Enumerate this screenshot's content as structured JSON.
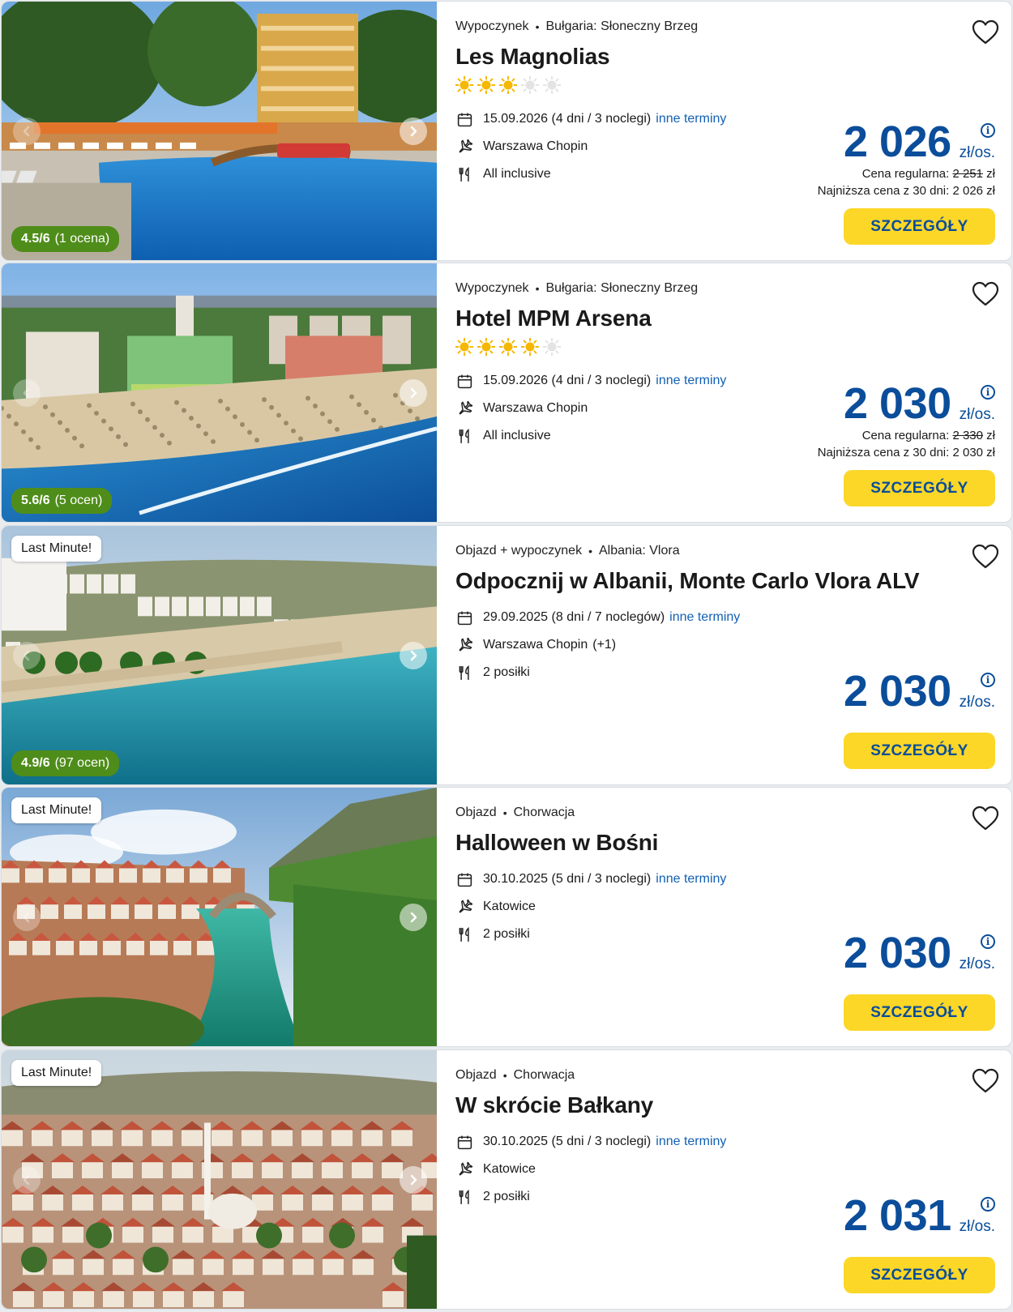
{
  "offers": [
    {
      "category": "Wypoczynek",
      "location": "Bułgaria: Słoneczny Brzeg",
      "title": "Les Magnolias",
      "stars_filled": 3,
      "stars_total": 5,
      "date": "15.09.2026 (4 dni / 3 noclegi)",
      "date_link": "inne terminy",
      "airport": "Warszawa Chopin",
      "airport_extra": "",
      "board": "All inclusive",
      "price": "2 026",
      "price_unit": "zł/os.",
      "regular_label": "Cena regularna: ",
      "regular_price": "2 251",
      "regular_currency": " zł",
      "lowest_price": "Najniższa cena z 30 dni: 2 026 zł",
      "rating_score": "4.5/6",
      "rating_count": "(1 ocena)",
      "badge": "",
      "button": "SZCZEGÓŁY",
      "photo": "pool"
    },
    {
      "category": "Wypoczynek",
      "location": "Bułgaria: Słoneczny Brzeg",
      "title": "Hotel MPM Arsena",
      "stars_filled": 4,
      "stars_total": 5,
      "date": "15.09.2026 (4 dni / 3 noclegi)",
      "date_link": "inne terminy",
      "airport": "Warszawa Chopin",
      "airport_extra": "",
      "board": "All inclusive",
      "price": "2 030",
      "price_unit": "zł/os.",
      "regular_label": "Cena regularna: ",
      "regular_price": "2 330",
      "regular_currency": " zł",
      "lowest_price": "Najniższa cena z 30 dni: 2 030 zł",
      "rating_score": "5.6/6",
      "rating_count": "(5 ocen)",
      "badge": "",
      "button": "SZCZEGÓŁY",
      "photo": "beach"
    },
    {
      "category": "Objazd + wypoczynek",
      "location": "Albania: Vlora",
      "title": "Odpocznij w Albanii, Monte Carlo Vlora ALV",
      "stars_filled": 0,
      "stars_total": 0,
      "date": "29.09.2025 (8 dni / 7 noclegów)",
      "date_link": "inne terminy",
      "airport": "Warszawa Chopin",
      "airport_extra": "(+1)",
      "board": "2 posiłki",
      "price": "2 030",
      "price_unit": "zł/os.",
      "regular_label": "",
      "regular_price": "",
      "regular_currency": "",
      "lowest_price": "",
      "rating_score": "4.9/6",
      "rating_count": "(97 ocen)",
      "badge": "Last Minute!",
      "button": "SZCZEGÓŁY",
      "photo": "coast"
    },
    {
      "category": "Objazd",
      "location": "Chorwacja",
      "title": "Halloween w Bośni",
      "stars_filled": 0,
      "stars_total": 0,
      "date": "30.10.2025 (5 dni / 3 noclegi)",
      "date_link": "inne terminy",
      "airport": "Katowice",
      "airport_extra": "",
      "board": "2 posiłki",
      "price": "2 030",
      "price_unit": "zł/os.",
      "regular_label": "",
      "regular_price": "",
      "regular_currency": "",
      "lowest_price": "",
      "rating_score": "",
      "rating_count": "",
      "badge": "Last Minute!",
      "button": "SZCZEGÓŁY",
      "photo": "river"
    },
    {
      "category": "Objazd",
      "location": "Chorwacja",
      "title": "W skrócie Bałkany",
      "stars_filled": 0,
      "stars_total": 0,
      "date": "30.10.2025 (5 dni / 3 noclegi)",
      "date_link": "inne terminy",
      "airport": "Katowice",
      "airport_extra": "",
      "board": "2 posiłki",
      "price": "2 031",
      "price_unit": "zł/os.",
      "regular_label": "",
      "regular_price": "",
      "regular_currency": "",
      "lowest_price": "",
      "rating_score": "",
      "rating_count": "",
      "badge": "Last Minute!",
      "button": "SZCZEGÓŁY",
      "photo": "town"
    }
  ],
  "colors": {
    "price_blue": "#0b4d9a",
    "link_blue": "#1260b3",
    "button_yellow": "#fcd728",
    "rating_green": "#4f8d1a",
    "star_gold": "#f5b700",
    "star_empty": "#e3e3e3"
  },
  "icons": {
    "date": "calendar-icon",
    "airport": "plane-icon",
    "board": "cutlery-icon",
    "favorite": "heart-icon",
    "price_info": "info-icon",
    "gallery_prev": "chevron-left-icon",
    "gallery_next": "chevron-right-icon",
    "star": "sun-star-icon"
  }
}
